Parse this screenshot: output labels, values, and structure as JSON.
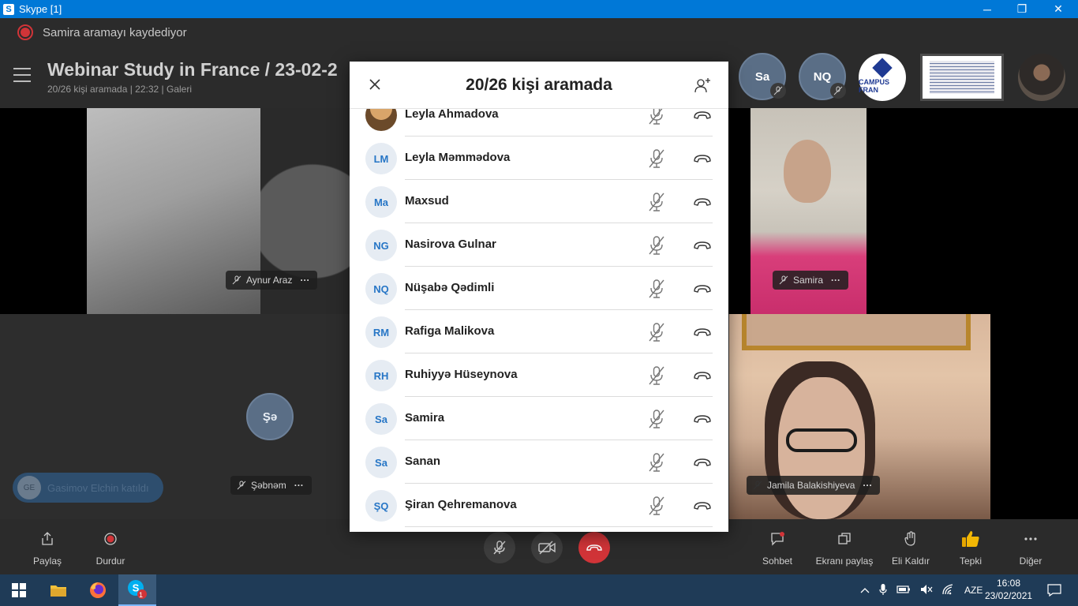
{
  "window": {
    "title": "Skype [1]",
    "minimize": "─",
    "restore": "❐",
    "close": "✕"
  },
  "recording": {
    "text": "Samira aramayı kaydediyor"
  },
  "call": {
    "title": "Webinar Study in France / 23-02-2",
    "subtitle": "20/26 kişi aramada | 22:32 |  Galeri",
    "header_participants": [
      {
        "initials": "Sa"
      },
      {
        "initials": "NQ"
      }
    ],
    "campus_logo_text": "CAMPUS FRAN"
  },
  "videos": {
    "aynur": {
      "name": "Aynur Araz"
    },
    "samira": {
      "name": "Samira"
    },
    "sebnem": {
      "name": "Şəbnəm",
      "initials": "Şə"
    },
    "jamila": {
      "name": "Jamila Balakishiyeva"
    },
    "more": "···"
  },
  "toast": {
    "avatar": "GE",
    "text": "Gasimov Elchin katıldı"
  },
  "controls": {
    "share": "Paylaş",
    "stop": "Durdur",
    "chat": "Sohbet",
    "screen_share": "Ekranı paylaş",
    "raise_hand": "Eli Kaldır",
    "react": "Tepki",
    "more": "Diğer"
  },
  "modal": {
    "title": "20/26 kişi aramada",
    "participants": [
      {
        "initials": "",
        "name": "Leyla Ahmadova",
        "photo": true
      },
      {
        "initials": "LM",
        "name": "Leyla Məmmədova"
      },
      {
        "initials": "Ma",
        "name": "Maxsud"
      },
      {
        "initials": "NG",
        "name": "Nasirova Gulnar"
      },
      {
        "initials": "NQ",
        "name": "Nüşabə Qədimli"
      },
      {
        "initials": "RM",
        "name": "Rafiga Malikova"
      },
      {
        "initials": "RH",
        "name": "Ruhiyyə Hüseynova"
      },
      {
        "initials": "Sa",
        "name": "Samira"
      },
      {
        "initials": "Sa",
        "name": "Sanan"
      },
      {
        "initials": "ŞQ",
        "name": "Şiran Qehremanova"
      }
    ]
  },
  "taskbar": {
    "language": "AZE",
    "time": "16:08",
    "date": "23/02/2021",
    "skype_badge": "1"
  },
  "colors": {
    "accent": "#0078d7",
    "end_call": "#d13438",
    "avatar_text": "#2776c6"
  }
}
